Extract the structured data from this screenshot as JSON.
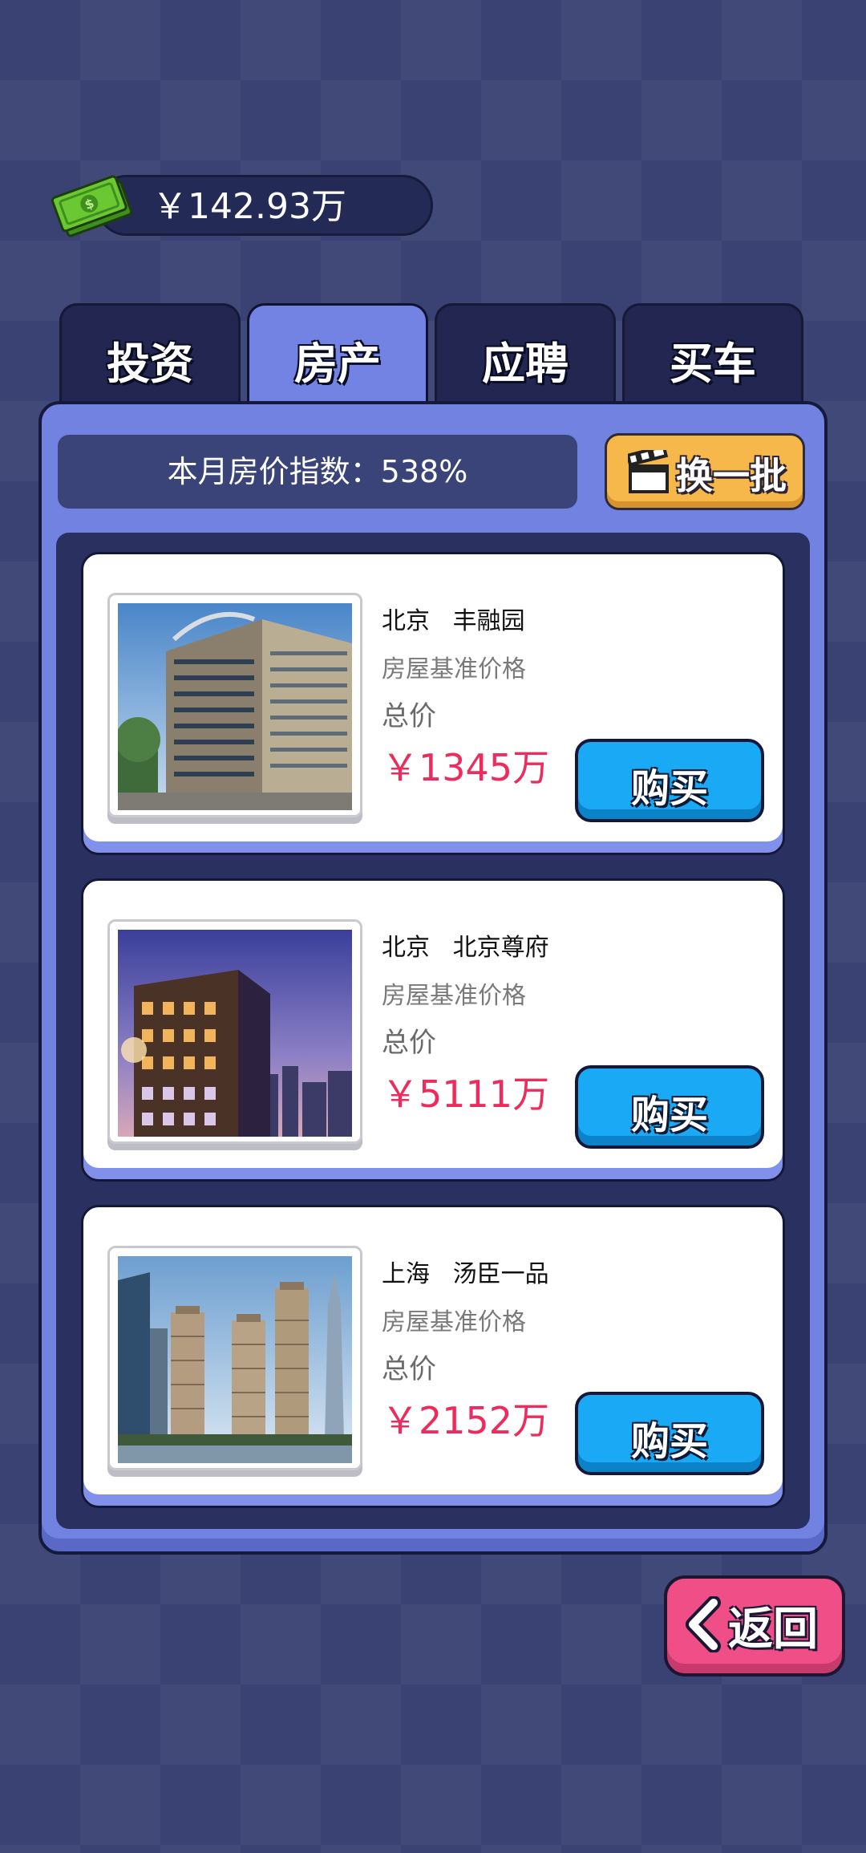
{
  "wallet": {
    "balance": "￥142.93万",
    "icon": "money-icon"
  },
  "tabs": [
    {
      "label": "投资",
      "active": false
    },
    {
      "label": "房产",
      "active": true
    },
    {
      "label": "应聘",
      "active": false
    },
    {
      "label": "买车",
      "active": false
    }
  ],
  "market": {
    "index_text": "本月房价指数：538%"
  },
  "refresh": {
    "label": "换一批",
    "icon": "clapperboard-icon"
  },
  "properties": [
    {
      "city": "北京",
      "name": "丰融园",
      "subtitle": "房屋基准价格",
      "total_label": "总价",
      "price": "￥1345万",
      "buy_label": "购买"
    },
    {
      "city": "北京",
      "name": "北京尊府",
      "subtitle": "房屋基准价格",
      "total_label": "总价",
      "price": "￥5111万",
      "buy_label": "购买"
    },
    {
      "city": "上海",
      "name": "汤臣一品",
      "subtitle": "房屋基准价格",
      "total_label": "总价",
      "price": "￥2152万",
      "buy_label": "购买"
    }
  ],
  "back": {
    "label": "返回",
    "icon": "chevron-left-icon"
  },
  "colors": {
    "accent_blue": "#1aa9f5",
    "price_red": "#ed2b5d",
    "refresh_yellow": "#f6b84a",
    "back_pink": "#ef4f86",
    "panel": "#7282e1"
  }
}
